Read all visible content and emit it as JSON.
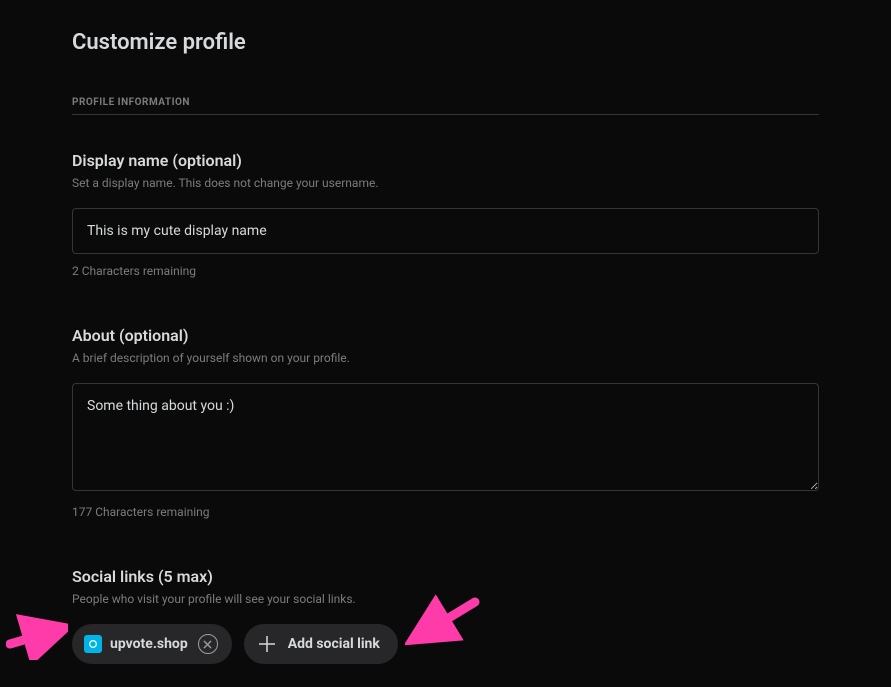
{
  "page_title": "Customize profile",
  "section_header": "PROFILE INFORMATION",
  "display_name": {
    "label": "Display name (optional)",
    "hint": "Set a display name. This does not change your username.",
    "value": "This is my cute display name",
    "counter": "2 Characters remaining"
  },
  "about": {
    "label": "About (optional)",
    "hint": "A brief description of yourself shown on your profile.",
    "value": "Some thing about you :)",
    "counter": "177 Characters remaining"
  },
  "social": {
    "label": "Social links (5 max)",
    "hint": "People who visit your profile will see your social links.",
    "items": [
      {
        "label": "upvote.shop"
      }
    ],
    "add_label": "Add social link"
  }
}
